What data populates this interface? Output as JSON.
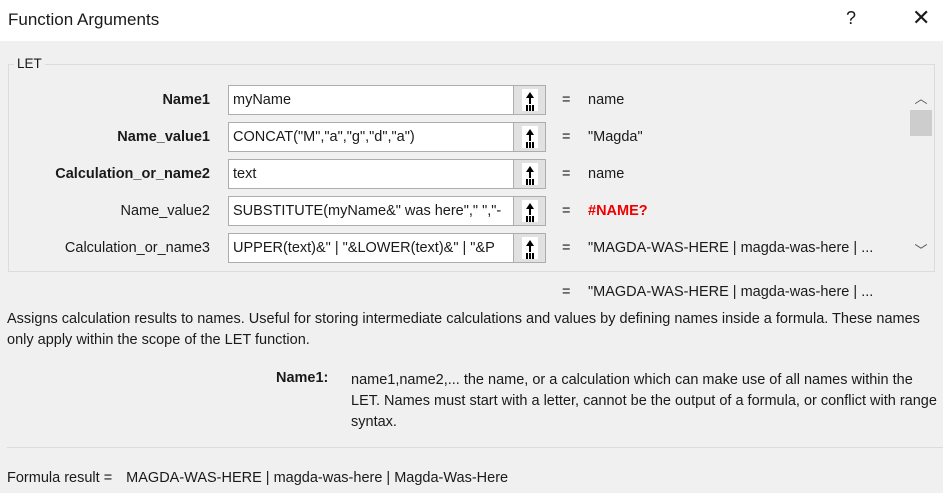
{
  "window": {
    "title": "Function Arguments",
    "help_label": "?",
    "close_label": "✕"
  },
  "function_name": "LET",
  "arguments": [
    {
      "label": "Name1",
      "bold": true,
      "value": "myName",
      "result": "name",
      "error": false
    },
    {
      "label": "Name_value1",
      "bold": true,
      "value": "CONCAT(\"M\",\"a\",\"g\",\"d\",\"a\")",
      "result": "\"Magda\"",
      "error": false
    },
    {
      "label": "Calculation_or_name2",
      "bold": true,
      "value": "text",
      "result": "name",
      "error": false
    },
    {
      "label": "Name_value2",
      "bold": false,
      "value": "SUBSTITUTE(myName&\" was here\",\" \",\"-",
      "result": "#NAME?",
      "error": true
    },
    {
      "label": "Calculation_or_name3",
      "bold": false,
      "value": "UPPER(text)&\" | \"&LOWER(text)&\" | \"&P",
      "result": "\"MAGDA-WAS-HERE | magda-was-here | ...",
      "error": false
    }
  ],
  "equals": "=",
  "scrollbar": {
    "up": "︿",
    "down": "﹀"
  },
  "function_result": "\"MAGDA-WAS-HERE | magda-was-here | ...",
  "description": "Assigns calculation results to names. Useful for storing intermediate calculations and values by defining names inside a formula. These names only apply within the scope of the LET function.",
  "argument_help": {
    "name": "Name1:",
    "text": "name1,name2,... the name, or a calculation which can make use of all names within the LET. Names must start with a letter, cannot be the output of a formula, or conflict with range syntax."
  },
  "formula_result": {
    "label": "Formula result =",
    "value": "MAGDA-WAS-HERE | magda-was-here | Magda-Was-Here"
  },
  "colors": {
    "error": "#ee0000",
    "background": "#f0f0f0"
  }
}
